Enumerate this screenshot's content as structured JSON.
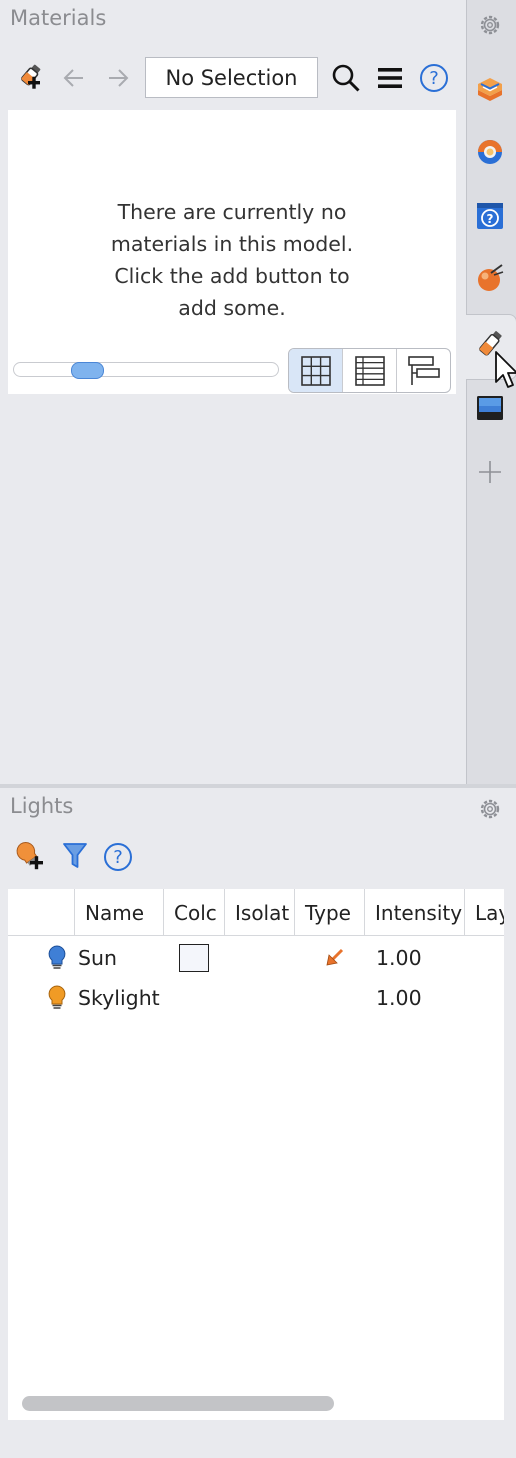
{
  "materials": {
    "title": "Materials",
    "selection_label": "No Selection",
    "empty_message": "There are currently no materials in this model. Click the add button to add some.",
    "empty_message_lines": [
      "There are currently no",
      "materials in this model.",
      "Click the add button to",
      "add some."
    ],
    "toolbar_icons": [
      "add-material-icon",
      "back-arrow-icon",
      "forward-arrow-icon",
      "search-icon",
      "menu-icon",
      "help-icon"
    ],
    "view_modes": [
      "grid-view-icon",
      "list-view-icon",
      "tree-view-icon"
    ],
    "active_view": "grid-view-icon"
  },
  "tabs": {
    "icons": [
      "gear-icon",
      "layers-icon",
      "environment-icon",
      "help-panel-icon",
      "render-icon",
      "materials-icon",
      "display-icon",
      "add-tab-icon"
    ],
    "active": "materials-icon"
  },
  "lights": {
    "title": "Lights",
    "toolbar_icons": [
      "add-light-icon",
      "filter-icon",
      "help-icon"
    ],
    "columns": [
      "Name",
      "Colc",
      "Isolat",
      "Type",
      "Intensity",
      "Lay"
    ],
    "rows": [
      {
        "name": "Sun",
        "intensity": "1.00",
        "bulb_color": "#3f7fd6",
        "has_color_swatch": true,
        "type_icon": "directional-arrow-icon"
      },
      {
        "name": "Skylight",
        "intensity": "1.00",
        "bulb_color": "#f09b25",
        "has_color_swatch": false,
        "type_icon": ""
      }
    ]
  },
  "colors": {
    "accent_blue": "#2a6fd6",
    "accent_orange": "#e8732c",
    "panel_bg": "#e9eaee"
  }
}
